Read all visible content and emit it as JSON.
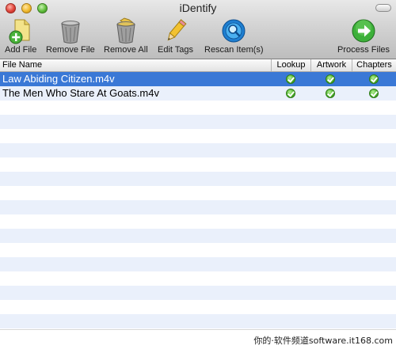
{
  "window": {
    "title": "iDentify"
  },
  "toolbar": {
    "add_file": "Add File",
    "remove_file": "Remove File",
    "remove_all": "Remove All",
    "edit_tags": "Edit Tags",
    "rescan_items": "Rescan Item(s)",
    "process_files": "Process Files"
  },
  "table": {
    "columns": {
      "file_name": "File Name",
      "lookup": "Lookup",
      "artwork": "Artwork",
      "chapters": "Chapters"
    },
    "rows": [
      {
        "file_name": "Law Abiding Citizen.m4v",
        "lookup": "done",
        "artwork": "done",
        "chapters": "done",
        "selected": true
      },
      {
        "file_name": "The Men Who Stare At Goats.m4v",
        "lookup": "done",
        "artwork": "done",
        "chapters": "done",
        "selected": false
      }
    ]
  },
  "colors": {
    "selection": "#3a78d6",
    "stripe": "#eaf0fb",
    "check_green": "#4fb52c"
  },
  "watermark": "你的·软件频道software.it168.com"
}
